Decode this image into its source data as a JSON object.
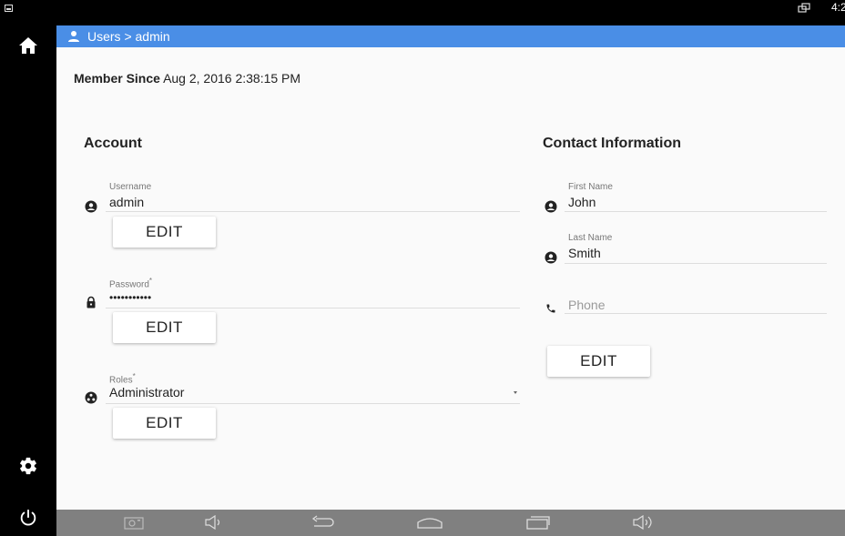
{
  "status_bar": {
    "time": "4:2",
    "left_icon": "screenshot-notification-icon",
    "right_icon": "window-overlay-icon"
  },
  "rail": {
    "home_icon": "home-icon",
    "settings_icon": "gear-icon",
    "power_icon": "power-icon"
  },
  "header": {
    "breadcrumb": "Users > admin",
    "icon": "person-icon"
  },
  "member": {
    "label": "Member Since",
    "value": "Aug 2, 2016 2:38:15 PM"
  },
  "account": {
    "title": "Account",
    "username": {
      "label": "Username",
      "value": "admin",
      "edit_label": "EDIT"
    },
    "password": {
      "label": "Password",
      "required": "*",
      "value": "•••••••••••",
      "edit_label": "EDIT"
    },
    "roles": {
      "label": "Roles",
      "required": "*",
      "value": "Administrator",
      "edit_label": "EDIT"
    }
  },
  "contact": {
    "title": "Contact Information",
    "first_name": {
      "label": "First Name",
      "value": "John"
    },
    "last_name": {
      "label": "Last Name",
      "value": "Smith"
    },
    "phone": {
      "placeholder": "Phone"
    },
    "edit_label": "EDIT"
  },
  "nav_bar": [
    "camera-icon",
    "volume-down-icon",
    "back-icon",
    "home-outline-icon",
    "recents-icon",
    "volume-up-icon"
  ],
  "colors": {
    "header_bg": "#4a8ee6",
    "content_bg": "#fafafa",
    "nav_bg": "#808080"
  }
}
